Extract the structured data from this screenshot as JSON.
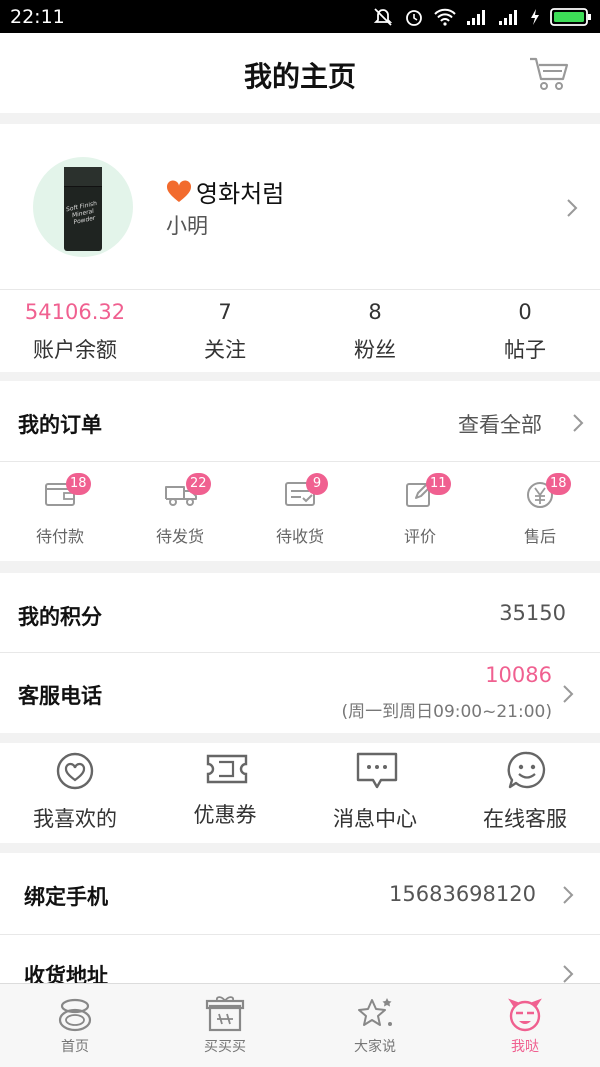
{
  "status_bar": {
    "time": "22:11"
  },
  "header": {
    "title": "我的主页"
  },
  "profile": {
    "nickname": "영화처럼",
    "username": "小明",
    "avatar_product_text": "Soft Finish Mineral Powder"
  },
  "stats": [
    {
      "value": "54106.32",
      "label": "账户余额",
      "highlight": true
    },
    {
      "value": "7",
      "label": "关注"
    },
    {
      "value": "8",
      "label": "粉丝"
    },
    {
      "value": "0",
      "label": "帖子"
    }
  ],
  "orders": {
    "title": "我的订单",
    "view_all": "查看全部",
    "items": [
      {
        "label": "待付款",
        "count": "18",
        "icon": "wallet-icon"
      },
      {
        "label": "待发货",
        "count": "22",
        "icon": "truck-icon"
      },
      {
        "label": "待收货",
        "count": "9",
        "icon": "package-check-icon"
      },
      {
        "label": "评价",
        "count": "11",
        "icon": "edit-icon"
      },
      {
        "label": "售后",
        "count": "18",
        "icon": "yen-icon"
      }
    ]
  },
  "points": {
    "label": "我的积分",
    "value": "35150"
  },
  "service": {
    "label": "客服电话",
    "phone": "10086",
    "hours": "(周一到周日09:00~21:00)"
  },
  "features": [
    {
      "label": "我喜欢的",
      "icon": "heart-circle-icon"
    },
    {
      "label": "优惠券",
      "icon": "ticket-icon"
    },
    {
      "label": "消息中心",
      "icon": "message-icon"
    },
    {
      "label": "在线客服",
      "icon": "smiley-chat-icon"
    }
  ],
  "bind_phone": {
    "label": "绑定手机",
    "value": "15683698120"
  },
  "address": {
    "label": "收货地址"
  },
  "tabs": [
    {
      "label": "首页",
      "icon": "compact-icon"
    },
    {
      "label": "买买买",
      "icon": "gift-icon"
    },
    {
      "label": "大家说",
      "icon": "stars-icon"
    },
    {
      "label": "我哒",
      "icon": "face-icon",
      "active": true
    }
  ],
  "colors": {
    "accent": "#f06090",
    "heart": "#f26b2e",
    "status_bar": "#000000"
  }
}
